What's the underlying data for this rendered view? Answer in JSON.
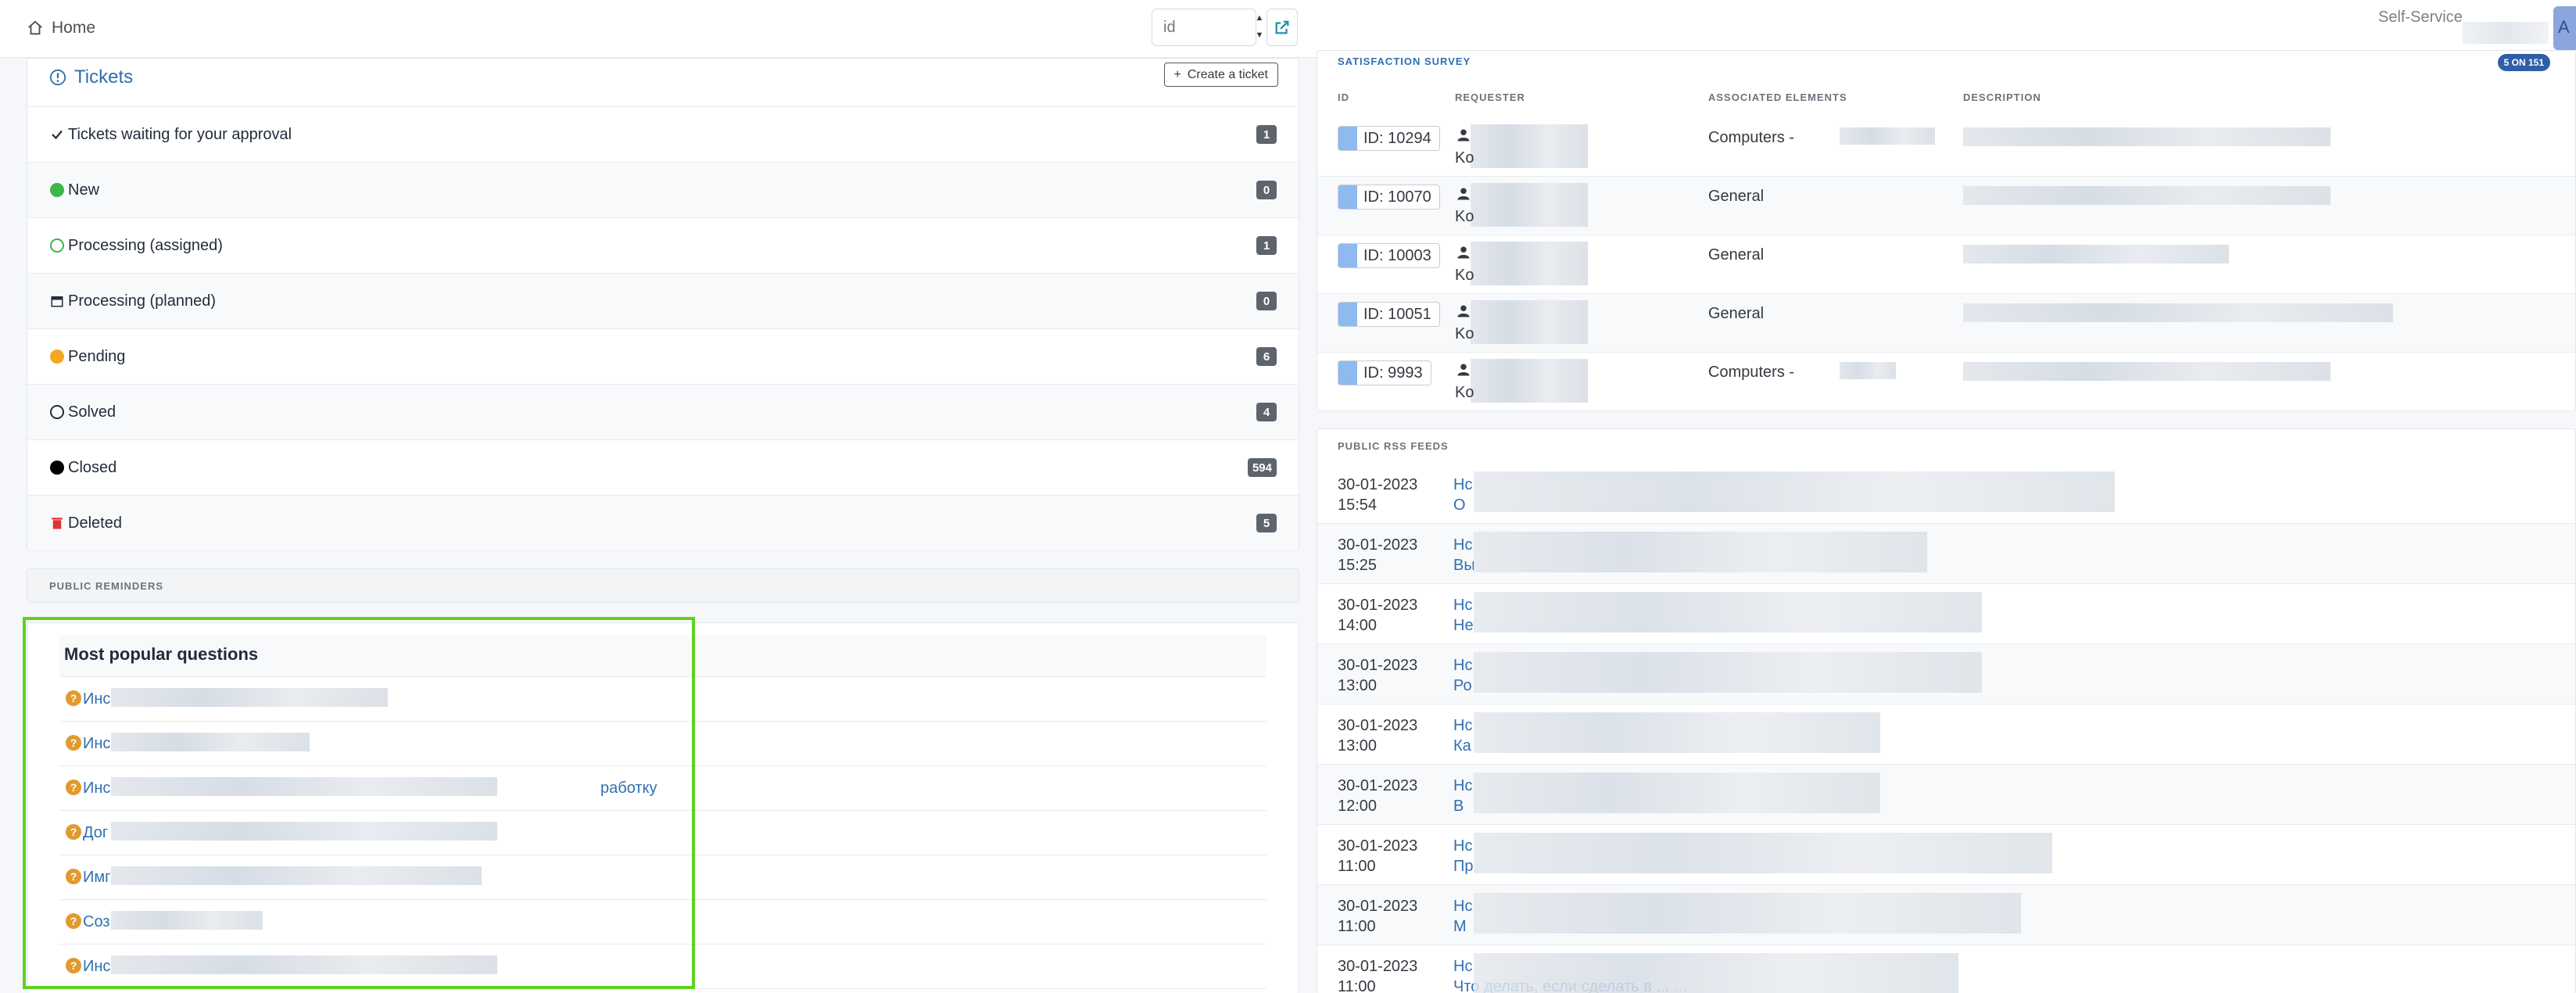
{
  "header": {
    "home_label": "Home",
    "id_placeholder": "id",
    "profile_label": "Self-Service",
    "avatar_initial": "A"
  },
  "tickets": {
    "title": "Tickets",
    "create_label": "Create a ticket",
    "rows": [
      {
        "label": "Tickets waiting for your approval",
        "count": "1",
        "icon": "check-icon"
      },
      {
        "label": "New",
        "count": "0",
        "icon": "new-status-icon",
        "color": "#3cb54a"
      },
      {
        "label": "Processing (assigned)",
        "count": "1",
        "icon": "assigned-status-icon",
        "color": "#3cb54a"
      },
      {
        "label": "Processing (planned)",
        "count": "0",
        "icon": "calendar-icon"
      },
      {
        "label": "Pending",
        "count": "6",
        "icon": "pending-status-icon",
        "color": "#f5a623"
      },
      {
        "label": "Solved",
        "count": "4",
        "icon": "solved-status-icon"
      },
      {
        "label": "Closed",
        "count": "594",
        "icon": "closed-status-icon",
        "color": "#000000"
      },
      {
        "label": "Deleted",
        "count": "5",
        "icon": "trash-icon",
        "color": "#e03131"
      }
    ]
  },
  "reminders": {
    "label": "PUBLIC REMINDERS"
  },
  "faq": {
    "title": "Most popular questions",
    "items": [
      {
        "text": "Инс"
      },
      {
        "text": "Инс"
      },
      {
        "text": "Инс",
        "suffix": "работку"
      },
      {
        "text": "Дог"
      },
      {
        "text": "Имг"
      },
      {
        "text": "Соз"
      },
      {
        "text": "Инс"
      }
    ]
  },
  "survey": {
    "label": "SATISFACTION SURVEY",
    "badge": "5 ON 151",
    "columns": [
      "ID",
      "REQUESTER",
      "ASSOCIATED ELEMENTS",
      "DESCRIPTION"
    ],
    "rows": [
      {
        "id": "ID: 10294",
        "requester": "Ko",
        "associated": "Computers -"
      },
      {
        "id": "ID: 10070",
        "requester": "Ko",
        "associated": "General"
      },
      {
        "id": "ID: 10003",
        "requester": "Ko",
        "associated": "General"
      },
      {
        "id": "ID: 10051",
        "requester": "Ko",
        "associated": "General"
      },
      {
        "id": "ID: 9993",
        "requester": "Ko",
        "associated": "Computers -"
      }
    ]
  },
  "rss": {
    "label": "PUBLIC RSS FEEDS",
    "rows": [
      {
        "date": "30-01-2023",
        "time": "15:54",
        "line1": "Нс",
        "line2": "О"
      },
      {
        "date": "30-01-2023",
        "time": "15:25",
        "line1": "Нс",
        "line2": "Вы"
      },
      {
        "date": "30-01-2023",
        "time": "14:00",
        "line1": "Нс",
        "line2": "Не"
      },
      {
        "date": "30-01-2023",
        "time": "13:00",
        "line1": "Нс",
        "line2": "Ро"
      },
      {
        "date": "30-01-2023",
        "time": "13:00",
        "line1": "Нс",
        "line2": "Ка"
      },
      {
        "date": "30-01-2023",
        "time": "12:00",
        "line1": "Нс",
        "line2": "В"
      },
      {
        "date": "30-01-2023",
        "time": "11:00",
        "line1": "Нс",
        "line2": "Пр"
      },
      {
        "date": "30-01-2023",
        "time": "11:00",
        "line1": "Нс",
        "line2": "М"
      },
      {
        "date": "30-01-2023",
        "time": "11:00",
        "line1": "Нс",
        "line2": "Что делать, если сделать в ... ..."
      }
    ]
  },
  "colors": {
    "accent": "#2f6fb2",
    "highlight": "#5fd21f",
    "badge": "#5d646d"
  }
}
